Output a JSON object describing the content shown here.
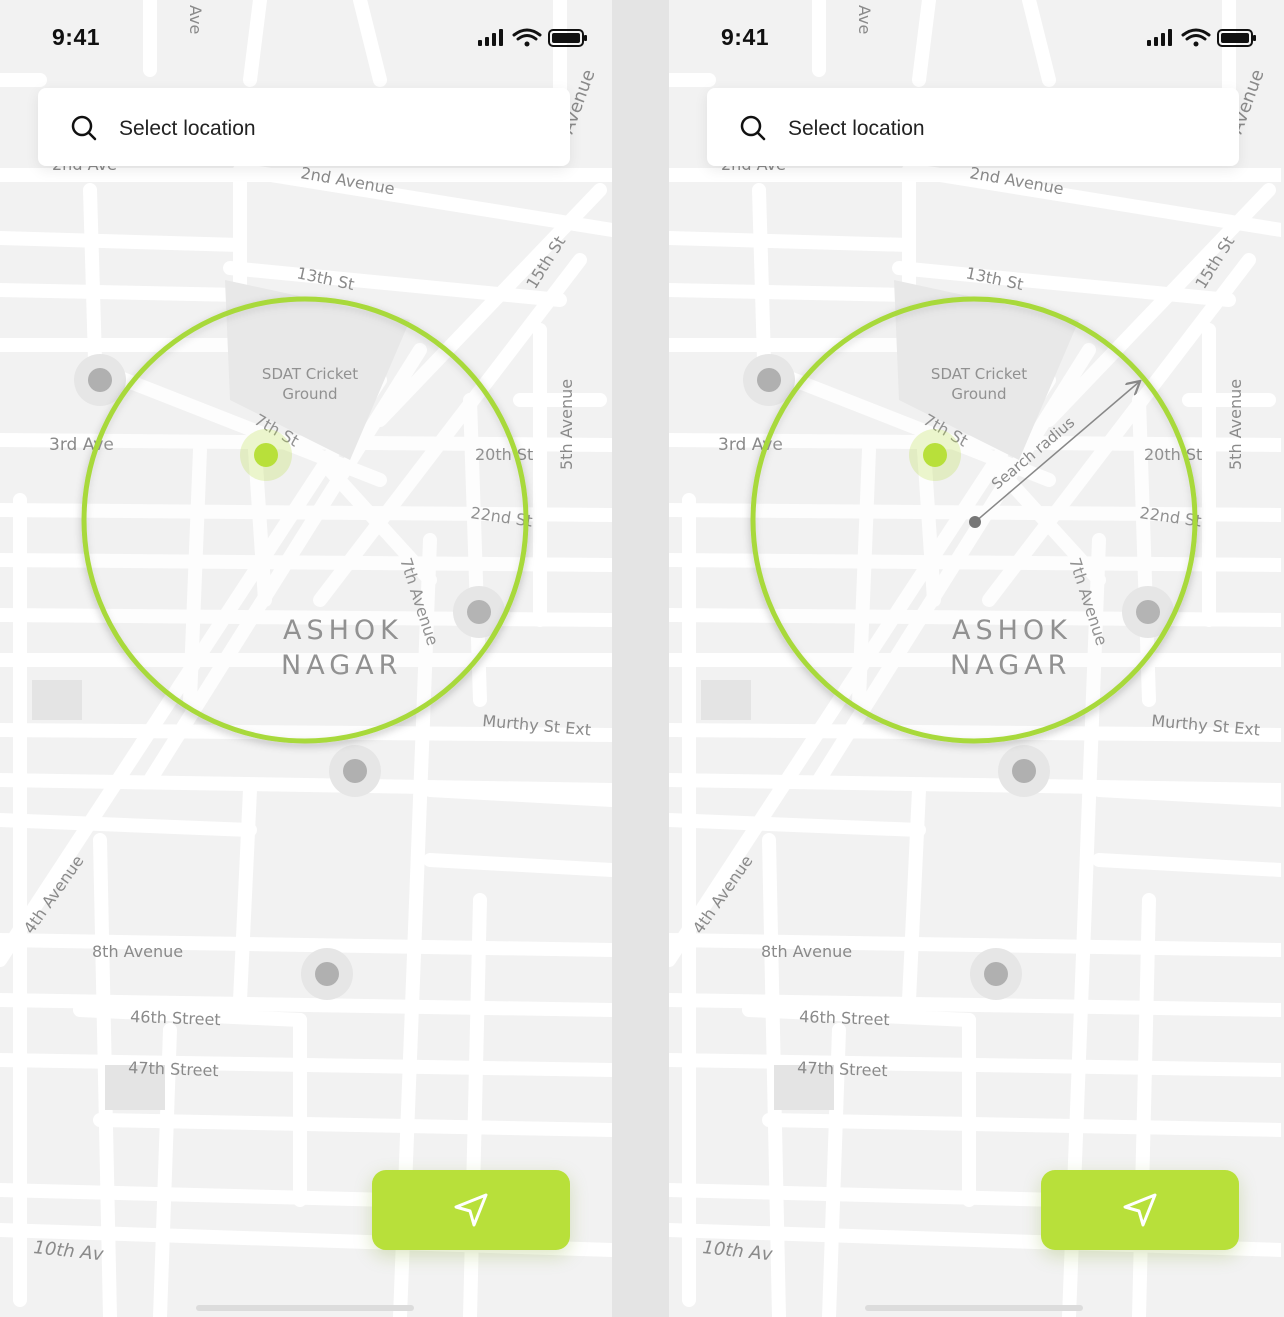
{
  "screens": [
    {
      "status": {
        "time": "9:41"
      },
      "search": {
        "label": "Select location"
      },
      "map": {
        "streets": [
          "2nd Ave",
          "2nd Avenue",
          "13th St",
          "15th St",
          "5th Avenue",
          "3rd Ave",
          "7th St",
          "20th St",
          "22nd St",
          "7th Avenue",
          "Murthy St Ext",
          "4th Avenue",
          "8th Avenue",
          "46th Street",
          "47th Street",
          "10th Av",
          "Avenue",
          "Ave"
        ],
        "landmark": "SDAT Cricket Ground",
        "landmark_lines": [
          "SDAT Cricket",
          "Ground"
        ],
        "area_lines": [
          "ASHOK",
          "NAGAR"
        ]
      },
      "nav_button": {
        "icon": "navigation-arrow-icon"
      }
    },
    {
      "status": {
        "time": "9:41"
      },
      "search": {
        "label": "Select location"
      },
      "map": {
        "streets": [
          "2nd Ave",
          "2nd Avenue",
          "13th St",
          "15th St",
          "5th Avenue",
          "3rd Ave",
          "7th St",
          "20th St",
          "22nd St",
          "7th Avenue",
          "Murthy St Ext",
          "4th Avenue",
          "8th Avenue",
          "46th Street",
          "47th Street",
          "10th Av",
          "Avenue",
          "Ave"
        ],
        "landmark": "SDAT Cricket Ground",
        "landmark_lines": [
          "SDAT Cricket",
          "Ground"
        ],
        "area_lines": [
          "ASHOK",
          "NAGAR"
        ],
        "radius_label": "Search radius"
      },
      "nav_button": {
        "icon": "navigation-arrow-icon"
      }
    }
  ],
  "colors": {
    "accent": "#b8e03a",
    "ring": "#a8d93a",
    "road": "#ffffff",
    "map_bg": "#f2f2f2",
    "pin": "#b0b0b0"
  }
}
